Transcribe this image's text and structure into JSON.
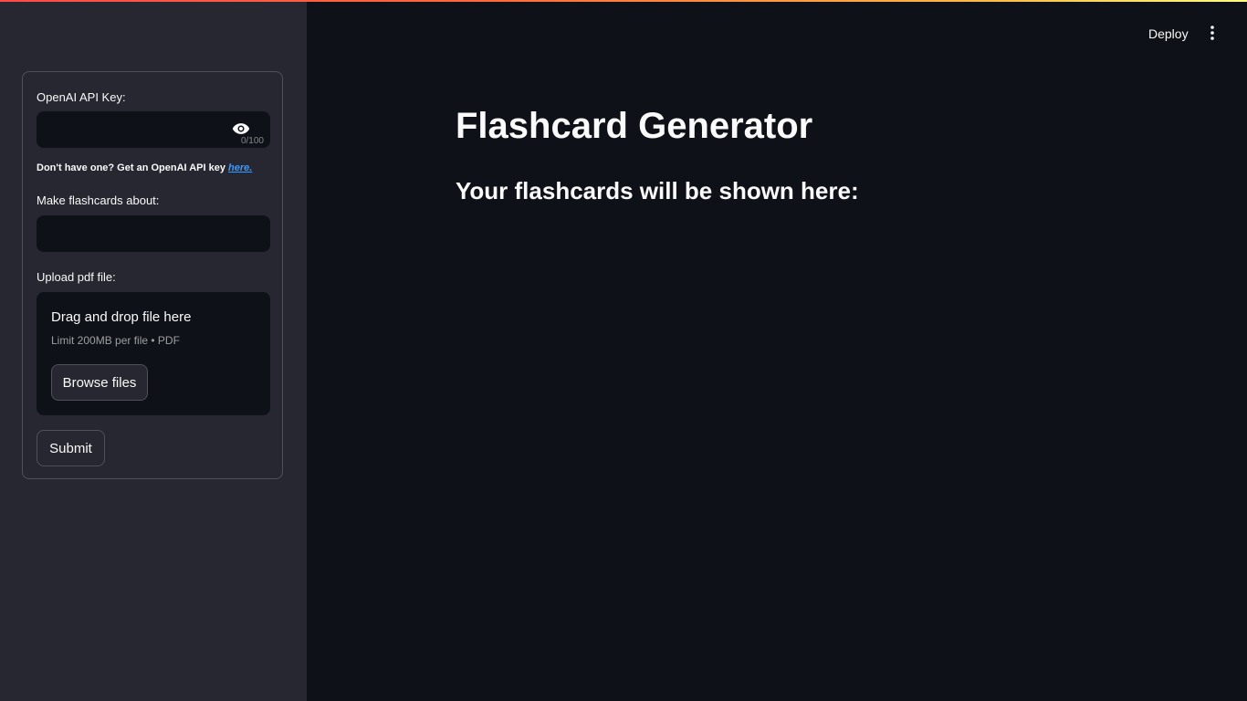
{
  "header": {
    "deploy_label": "Deploy",
    "menu_icon": "vertical-dots-icon"
  },
  "sidebar": {
    "api_key": {
      "label": "OpenAI API Key:",
      "value": "",
      "char_count": "0/100",
      "visibility_icon": "eye-icon"
    },
    "help": {
      "text": "Don't have one? Get an OpenAI API key ",
      "link_text": "here."
    },
    "topic": {
      "label": "Make flashcards about:",
      "value": ""
    },
    "upload": {
      "label": "Upload pdf file:",
      "drop_text": "Drag and drop file here",
      "limit_text": "Limit 200MB per file • PDF",
      "browse_label": "Browse files"
    },
    "submit_label": "Submit"
  },
  "main": {
    "title": "Flashcard Generator",
    "subtitle": "Your flashcards will be shown here:"
  },
  "colors": {
    "background": "#0e1117",
    "sidebar": "#262730",
    "link": "#3b9bff",
    "text": "#fafafa"
  }
}
